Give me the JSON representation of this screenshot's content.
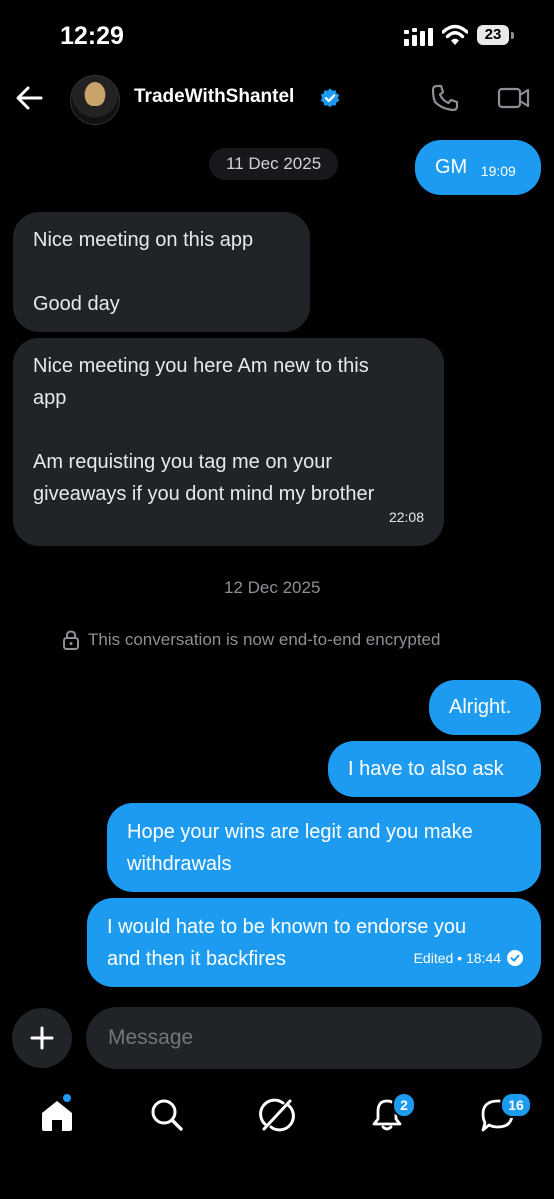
{
  "status_bar": {
    "time": "12:29",
    "battery": "23"
  },
  "header": {
    "contact_name": "TradeWithShantel"
  },
  "messages": {
    "date_1": "11 Dec 2025",
    "gm": {
      "text": "GM",
      "time": "19:09"
    },
    "m1_line1": "Nice meeting on this app",
    "m1_line2": "Good day",
    "m2_line1": "Nice meeting you here Am  new to this",
    "m2_line2": "app",
    "m2_line3": "Am requisting you tag me on your",
    "m2_line4": "giveaways if you dont mind my brother",
    "m2_time": "22:08",
    "date_2": "12 Dec 2025",
    "encryption_notice": "This conversation is now end-to-end encrypted",
    "o1": "Alright.",
    "o2": "I have to also ask",
    "o3_line1": "Hope your wins are legit and you make",
    "o3_line2": "withdrawals",
    "o4_line1": "I would hate to be known to endorse you",
    "o4_line2": "and then it backfires",
    "o4_meta": "Edited • 18:44"
  },
  "composer": {
    "placeholder": "Message"
  },
  "bottom_nav": {
    "notifications_badge": "2",
    "messages_badge": "16",
    "icons": [
      "home-icon",
      "search-icon",
      "grok-icon",
      "bell-icon",
      "messages-icon"
    ]
  },
  "colors": {
    "accent": "#1d9bf0",
    "incoming_bubble": "#202327",
    "background": "#000000"
  }
}
